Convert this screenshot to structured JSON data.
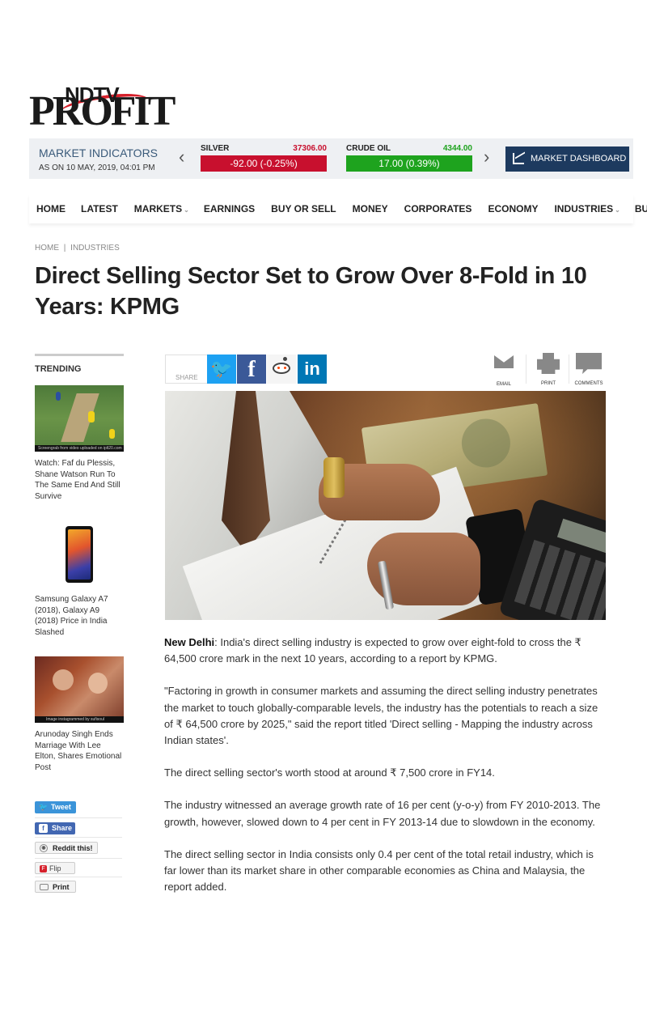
{
  "brand": {
    "ndtv": "NDTV",
    "profit": "PROFIT"
  },
  "market": {
    "title": "MARKET INDICATORS",
    "as_on": "AS ON 10 MAY, 2019, 04:01 PM",
    "prev": "‹",
    "next": "›",
    "items": [
      {
        "name": "SILVER",
        "value": "37306.00",
        "change": "-92.00 (-0.25%)",
        "color": "#c8102e"
      },
      {
        "name": "CRUDE OIL",
        "value": "4344.00",
        "change": "17.00 (0.39%)",
        "color": "#1ea31e"
      }
    ],
    "dashboard": "MARKET DASHBOARD"
  },
  "nav": [
    {
      "label": "HOME"
    },
    {
      "label": "LATEST"
    },
    {
      "label": "MARKETS",
      "dropdown": true
    },
    {
      "label": "EARNINGS"
    },
    {
      "label": "BUY OR SELL"
    },
    {
      "label": "MONEY"
    },
    {
      "label": "CORPORATES"
    },
    {
      "label": "ECONOMY"
    },
    {
      "label": "INDUSTRIES",
      "dropdown": true
    },
    {
      "label": "BUDGET"
    }
  ],
  "breadcrumb": {
    "home": "HOME",
    "sep": "|",
    "section": "INDUSTRIES"
  },
  "article": {
    "title": "Direct Selling Sector Set to Grow Over 8-Fold in 10 Years: KPMG",
    "dateline": "New Delhi",
    "paragraphs": [
      ": India's direct selling industry is expected to grow over eight-fold to cross the ₹ 64,500 crore mark in the next 10 years, according to a report by KPMG.",
      "\"Factoring in growth in consumer markets and assuming the direct selling industry penetrates the market to touch globally-comparable levels, the industry has the potentials to reach a size of ₹ 64,500 crore by 2025,\" said the report titled 'Direct selling - Mapping the industry across Indian states'.",
      "The direct selling sector's worth stood at around ₹ 7,500 crore in FY14.",
      "The industry witnessed an average growth rate of 16 per cent (y-o-y) from FY 2010-2013. The growth, however, slowed down to 4 per cent in FY 2013-14 due to slowdown in the economy.",
      "The direct selling sector in India consists only 0.4 per cent of the total retail industry, which is far lower than its market share in other comparable economies as China and Malaysia, the report added."
    ]
  },
  "share": {
    "label": "SHARE",
    "twitter": "🐦",
    "facebook": "f",
    "linkedin": "in",
    "email": "EMAIL",
    "print": "PRINT",
    "comments": "COMMENTS"
  },
  "trending": {
    "heading": "TRENDING",
    "items": [
      {
        "caption": "Watch: Faf du Plessis, Shane Watson Run To The Same End And Still Survive",
        "credit": "Screengrab from video uploaded on iplt20.com"
      },
      {
        "caption": "Samsung Galaxy A7 (2018), Galaxy A9 (2018) Price in India Slashed"
      },
      {
        "caption": "Arunoday Singh Ends Marriage With Lee Elton, Shares Emotional Post",
        "credit": "Image instagrammed by sufisoul"
      }
    ]
  },
  "social": {
    "tweet": "Tweet",
    "share": "Share",
    "reddit": "Reddit this!",
    "flip": "Flip",
    "print": "Print",
    "tweet_icon": "🐦",
    "fb_icon": "f",
    "reddit_icon": "◉",
    "flip_icon": "F"
  }
}
